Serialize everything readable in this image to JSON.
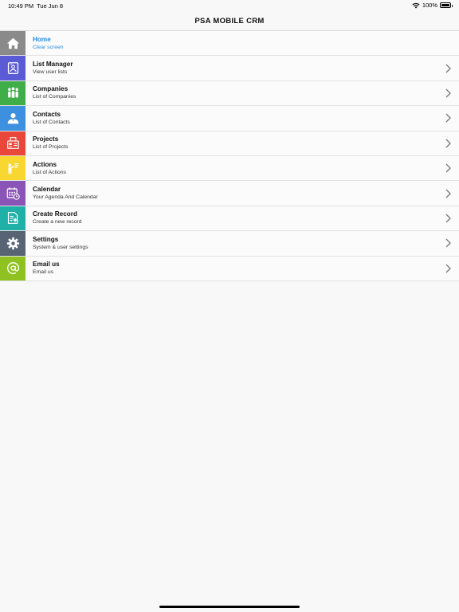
{
  "status": {
    "time": "10:49 PM",
    "date": "Tue Jun 8",
    "battery": "100%"
  },
  "app": {
    "title": "PSA MOBILE CRM"
  },
  "menu": [
    {
      "label": "Home",
      "subtitle": "Clear screen",
      "icon": "home-icon",
      "color": "#8a8a8a",
      "active": true
    },
    {
      "label": "List Manager",
      "subtitle": "View user lists",
      "icon": "list-manager-icon",
      "color": "#5b5bd6"
    },
    {
      "label": "Companies",
      "subtitle": "List of Companies",
      "icon": "companies-icon",
      "color": "#3fae49"
    },
    {
      "label": "Contacts",
      "subtitle": "List of Contacts",
      "icon": "contacts-icon",
      "color": "#3d8fe0"
    },
    {
      "label": "Projects",
      "subtitle": "List of Projects",
      "icon": "projects-icon",
      "color": "#e8473a"
    },
    {
      "label": "Actions",
      "subtitle": "List of Actions",
      "icon": "actions-icon",
      "color": "#f7d730"
    },
    {
      "label": "Calendar",
      "subtitle": "Your Agenda And Calendar",
      "icon": "calendar-icon",
      "color": "#8b55b8"
    },
    {
      "label": "Create Record",
      "subtitle": "Create a new record",
      "icon": "create-record-icon",
      "color": "#1fb0a8"
    },
    {
      "label": "Settings",
      "subtitle": "System & user settings",
      "icon": "gear-icon",
      "color": "#586374"
    },
    {
      "label": "Email us",
      "subtitle": "Email us",
      "icon": "at-icon",
      "color": "#8fc220"
    }
  ]
}
